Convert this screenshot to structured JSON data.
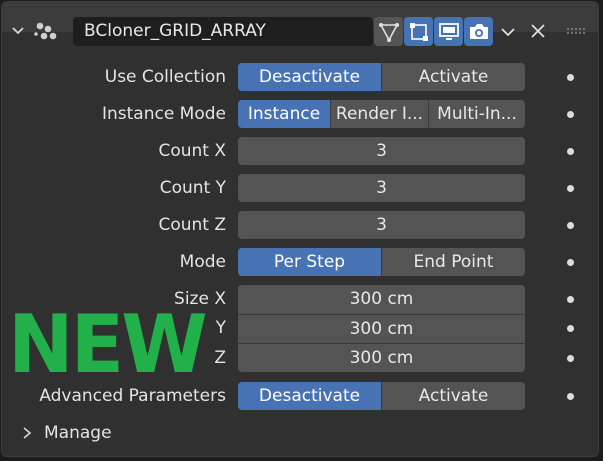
{
  "header": {
    "name": "BCloner_GRID_ARRAY",
    "icons": [
      "collapse-chevron-icon",
      "geometry-nodes-icon",
      "filter-icon",
      "edit-mode-icon",
      "viewport-monitor-icon",
      "camera-render-icon",
      "dropdown-chevron-icon",
      "close-icon",
      "drag-handle-icon"
    ]
  },
  "rows": {
    "use_collection": {
      "label": "Use Collection",
      "options": [
        "Desactivate",
        "Activate"
      ],
      "selected": "Desactivate"
    },
    "instance_mode": {
      "label": "Instance Mode",
      "options": [
        "Instance",
        "Render I...",
        "Multi-In..."
      ],
      "selected": "Instance"
    },
    "count_x": {
      "label": "Count X",
      "value": "3"
    },
    "count_y": {
      "label": "Count Y",
      "value": "3"
    },
    "count_z": {
      "label": "Count Z",
      "value": "3"
    },
    "mode": {
      "label": "Mode",
      "options": [
        "Per Step",
        "End Point"
      ],
      "selected": "Per Step"
    },
    "size": {
      "label_x": "Size X",
      "label_y": "Y",
      "label_z": "Z",
      "x": "300 cm",
      "y": "300 cm",
      "z": "300 cm"
    },
    "advanced": {
      "label": "Advanced Parameters",
      "options": [
        "Desactivate",
        "Activate"
      ],
      "selected": "Desactivate"
    }
  },
  "badge": "NEW",
  "manage": {
    "label": "Manage"
  },
  "colors": {
    "accent": "#4772b3",
    "field": "#545454",
    "panel": "#303030",
    "badge": "#22b04b"
  }
}
